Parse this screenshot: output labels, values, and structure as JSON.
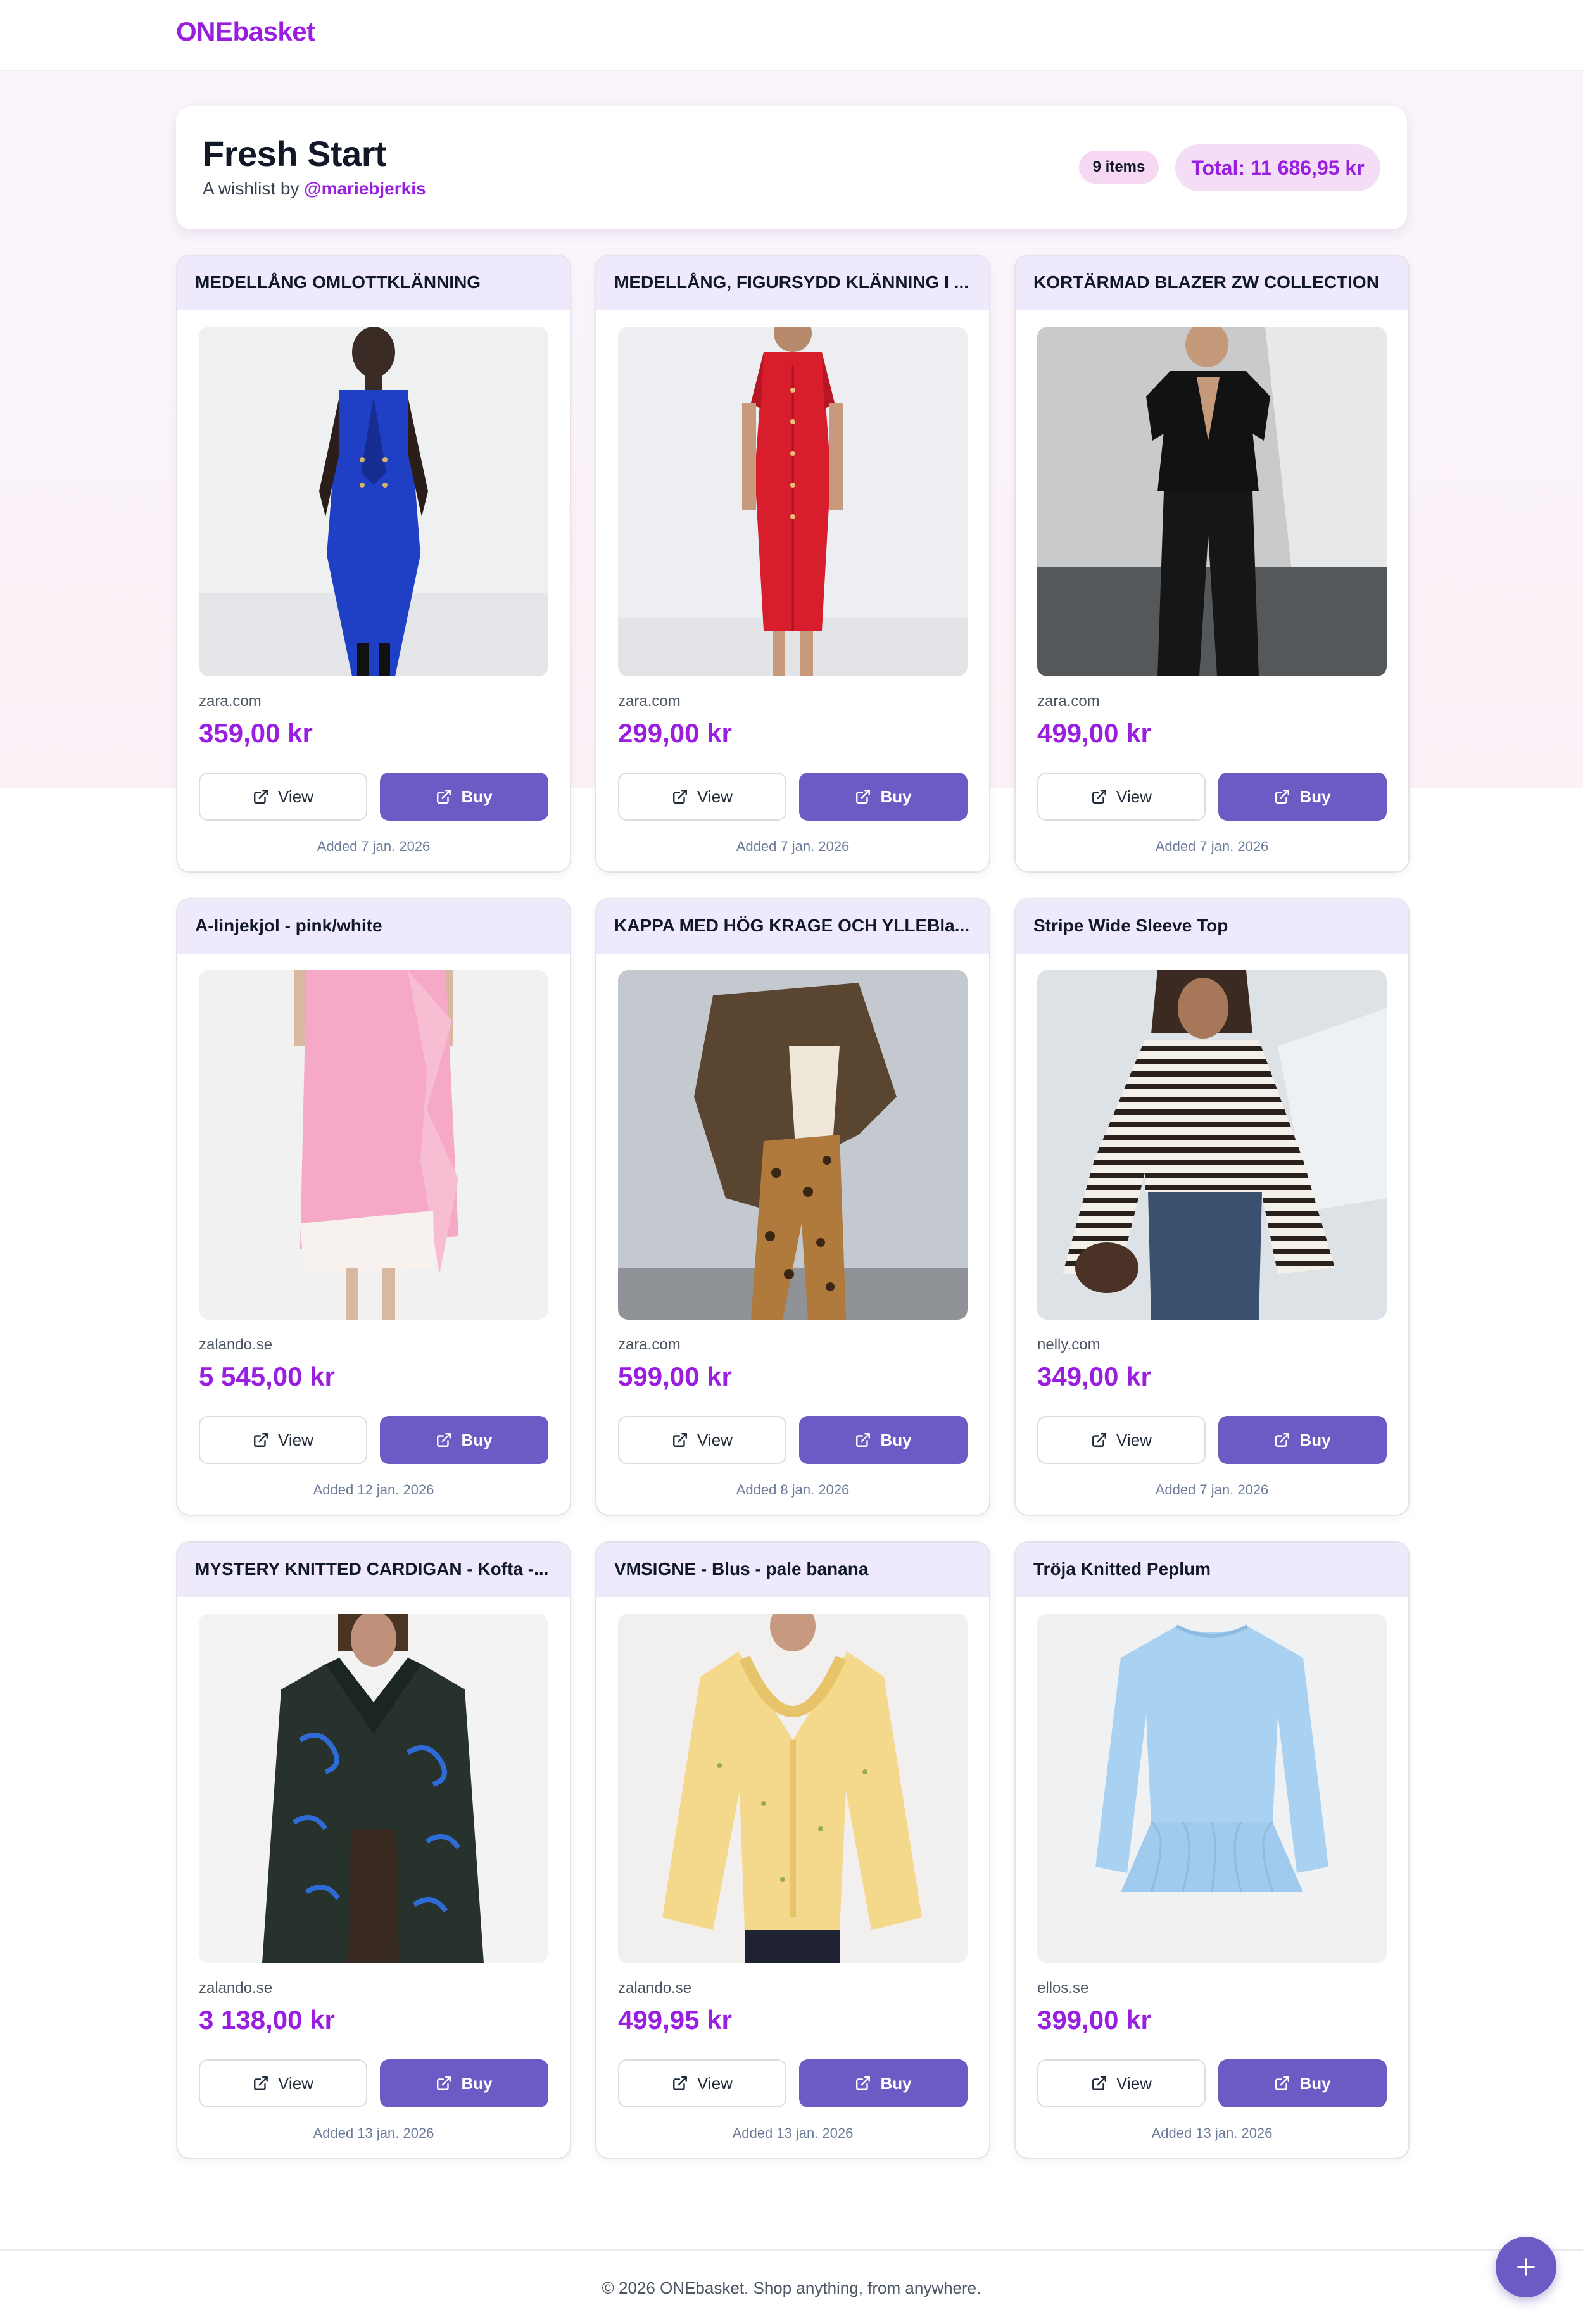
{
  "app": {
    "brand": "ONEbasket"
  },
  "wishlist": {
    "title": "Fresh Start",
    "by_prefix": "A wishlist by ",
    "owner": "@mariebjerkis",
    "count_label": "9 items",
    "total_label": "Total: 11 686,95 kr"
  },
  "buttons": {
    "view": "View",
    "buy": "Buy"
  },
  "items": [
    {
      "title": "MEDELLÅNG OMLOTTKLÄNNING",
      "store": "zara.com",
      "price": "359,00 kr",
      "added": "Added 7 jan. 2026"
    },
    {
      "title": "MEDELLÅNG, FIGURSYDD KLÄNNING I ...",
      "store": "zara.com",
      "price": "299,00 kr",
      "added": "Added 7 jan. 2026"
    },
    {
      "title": "KORTÄRMAD BLAZER ZW COLLECTION",
      "store": "zara.com",
      "price": "499,00 kr",
      "added": "Added 7 jan. 2026"
    },
    {
      "title": "A-linjekjol - pink/white",
      "store": "zalando.se",
      "price": "5 545,00 kr",
      "added": "Added 12 jan. 2026"
    },
    {
      "title": "KAPPA MED HÖG KRAGE OCH YLLEBla...",
      "store": "zara.com",
      "price": "599,00 kr",
      "added": "Added 8 jan. 2026"
    },
    {
      "title": "Stripe Wide Sleeve Top",
      "store": "nelly.com",
      "price": "349,00 kr",
      "added": "Added 7 jan. 2026"
    },
    {
      "title": "MYSTERY KNITTED CARDIGAN - Kofta -...",
      "store": "zalando.se",
      "price": "3 138,00 kr",
      "added": "Added 13 jan. 2026"
    },
    {
      "title": "VMSIGNE - Blus - pale banana",
      "store": "zalando.se",
      "price": "499,95 kr",
      "added": "Added 13 jan. 2026"
    },
    {
      "title": "Tröja Knitted Peplum",
      "store": "ellos.se",
      "price": "399,00 kr",
      "added": "Added 13 jan. 2026"
    }
  ],
  "footer": {
    "text": "© 2026 ONEbasket. Shop anything, from anywhere."
  },
  "colors": {
    "brand": "#9a1ee0",
    "button": "#6c5bc4",
    "card_header": "#eeeafb"
  }
}
